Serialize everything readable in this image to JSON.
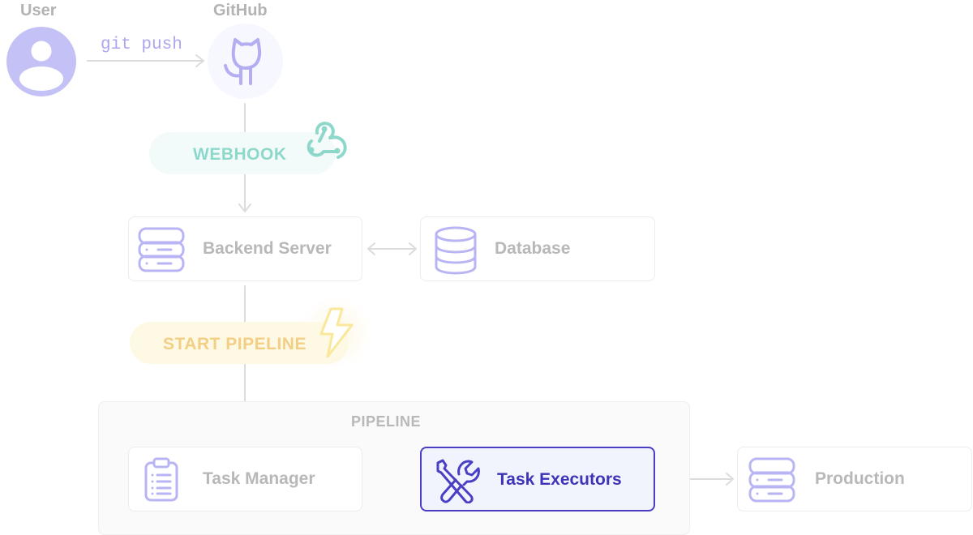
{
  "actors": {
    "user": {
      "label": "User",
      "icon": "user-avatar-icon"
    },
    "github": {
      "label": "GitHub",
      "icon": "github-octocat-icon"
    }
  },
  "edges": {
    "git_push": {
      "label": "git push"
    }
  },
  "events": {
    "webhook": {
      "label": "WEBHOOK",
      "icon": "webhook-icon",
      "color": "#8ed8cb"
    },
    "start_pipeline": {
      "label": "START PIPELINE",
      "icon": "lightning-bolt-icon",
      "color": "#f2cf84"
    }
  },
  "nodes": {
    "backend_server": {
      "label": "Backend Server",
      "icon": "server-stack-icon"
    },
    "database": {
      "label": "Database",
      "icon": "database-icon"
    },
    "task_manager": {
      "label": "Task Manager",
      "icon": "clipboard-list-icon"
    },
    "task_executors": {
      "label": "Task Executors",
      "icon": "tools-icon",
      "state": "active"
    },
    "production": {
      "label": "Production",
      "icon": "server-stack-icon"
    }
  },
  "groups": {
    "pipeline": {
      "label": "PIPELINE"
    }
  },
  "colors": {
    "accent": "#4a3fc4",
    "icon_lavender": "#b9b4f3",
    "muted_text": "#b8b8b8",
    "connector": "#dcdcdc"
  }
}
